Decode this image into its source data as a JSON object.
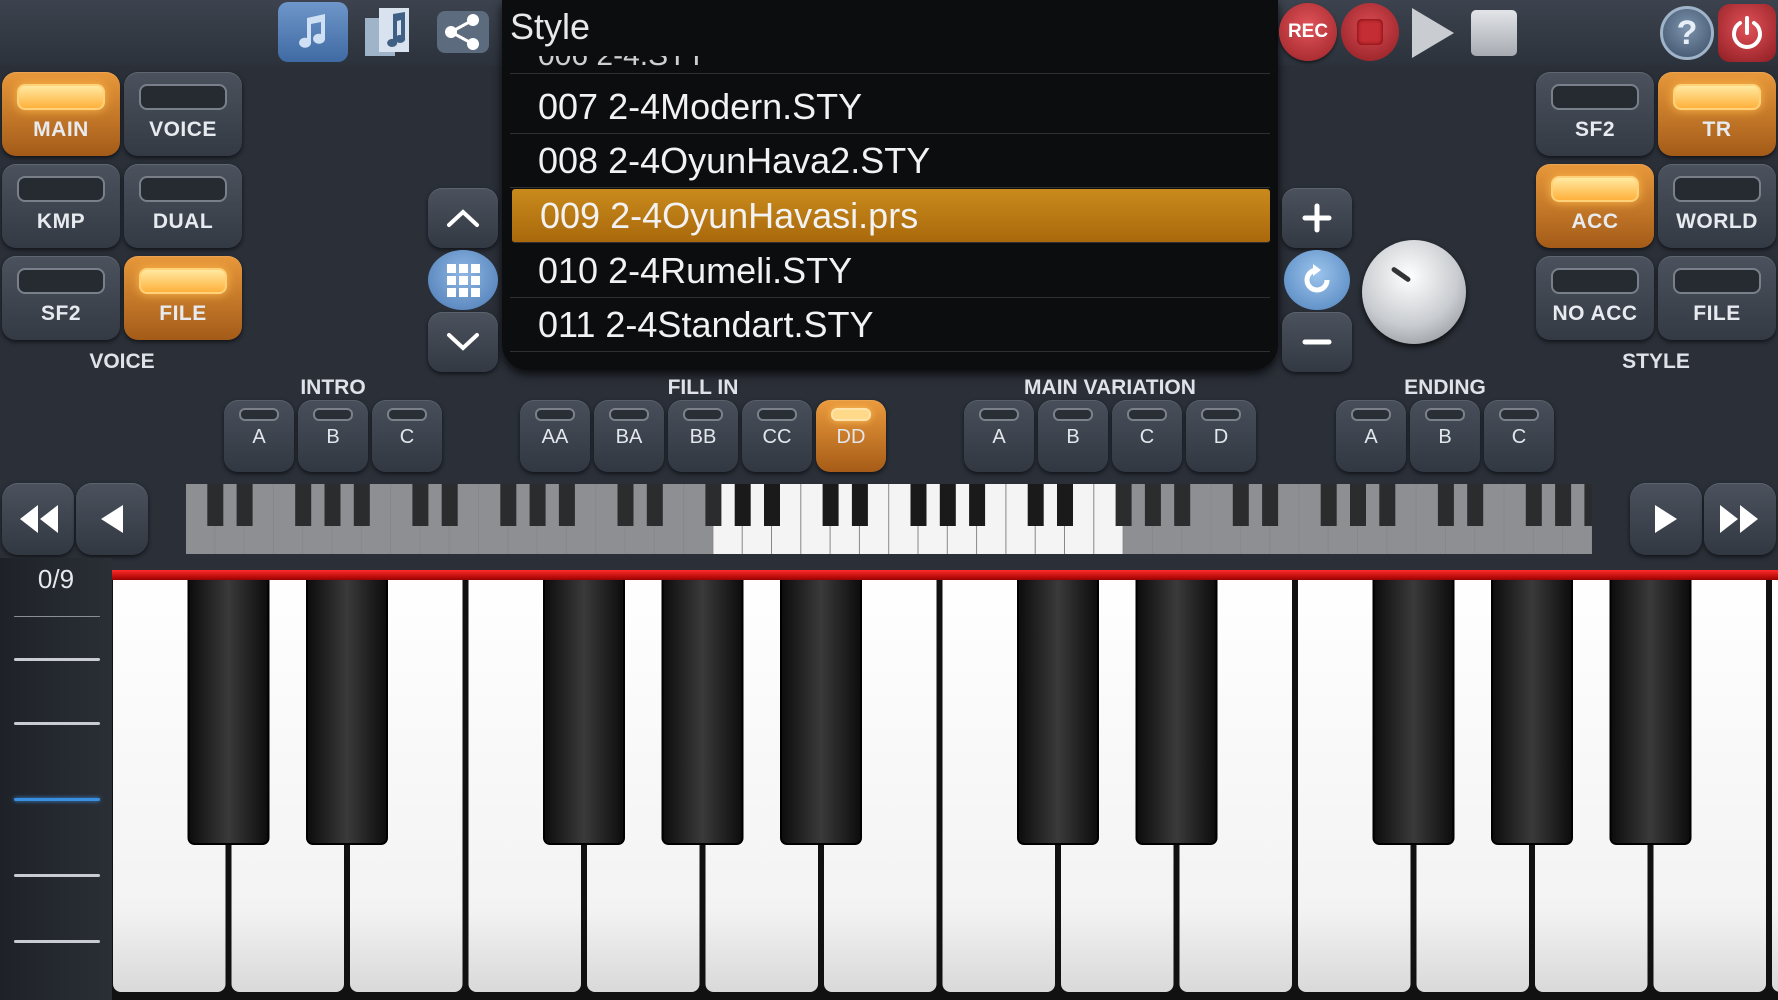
{
  "topbar": {
    "icons": [
      "music-library-icon",
      "music-notes-icon",
      "share-icon"
    ],
    "rec_label": "REC",
    "help_label": "?"
  },
  "style_list": {
    "title": "Style",
    "partial_top": "006 2-4.STY",
    "items": [
      "007 2-4Modern.STY",
      "008 2-4OyunHava2.STY",
      "009 2-4OyunHavasi.prs",
      "010 2-4Rumeli.STY",
      "011 2-4Standart.STY"
    ],
    "selected_index": 2
  },
  "voice_panel": {
    "section_label": "VOICE",
    "buttons": [
      {
        "label": "MAIN",
        "on": true
      },
      {
        "label": "VOICE",
        "on": false
      },
      {
        "label": "KMP",
        "on": false
      },
      {
        "label": "DUAL",
        "on": false
      },
      {
        "label": "SF2",
        "on": false
      },
      {
        "label": "FILE",
        "on": true
      }
    ]
  },
  "style_panel": {
    "section_label": "STYLE",
    "buttons": [
      {
        "label": "SF2",
        "on": false
      },
      {
        "label": "TR",
        "on": true
      },
      {
        "label": "ACC",
        "on": true
      },
      {
        "label": "WORLD",
        "on": false
      },
      {
        "label": "NO ACC",
        "on": false
      },
      {
        "label": "FILE",
        "on": false
      }
    ]
  },
  "variations": {
    "intro": {
      "label": "INTRO",
      "buttons": [
        "A",
        "B",
        "C"
      ]
    },
    "fill_in": {
      "label": "FILL IN",
      "buttons": [
        "AA",
        "BA",
        "BB",
        "CC",
        "DD"
      ],
      "active": "DD"
    },
    "main_variation": {
      "label": "MAIN VARIATION",
      "buttons": [
        "A",
        "B",
        "C",
        "D"
      ]
    },
    "ending": {
      "label": "ENDING",
      "buttons": [
        "A",
        "B",
        "C"
      ]
    }
  },
  "octave_indicator": "0/9",
  "colors": {
    "accent_orange": "#e8983b",
    "selected_row": "#b97a14",
    "rec_red": "#c42d33",
    "key_bar_red": "#ff2a2a"
  }
}
